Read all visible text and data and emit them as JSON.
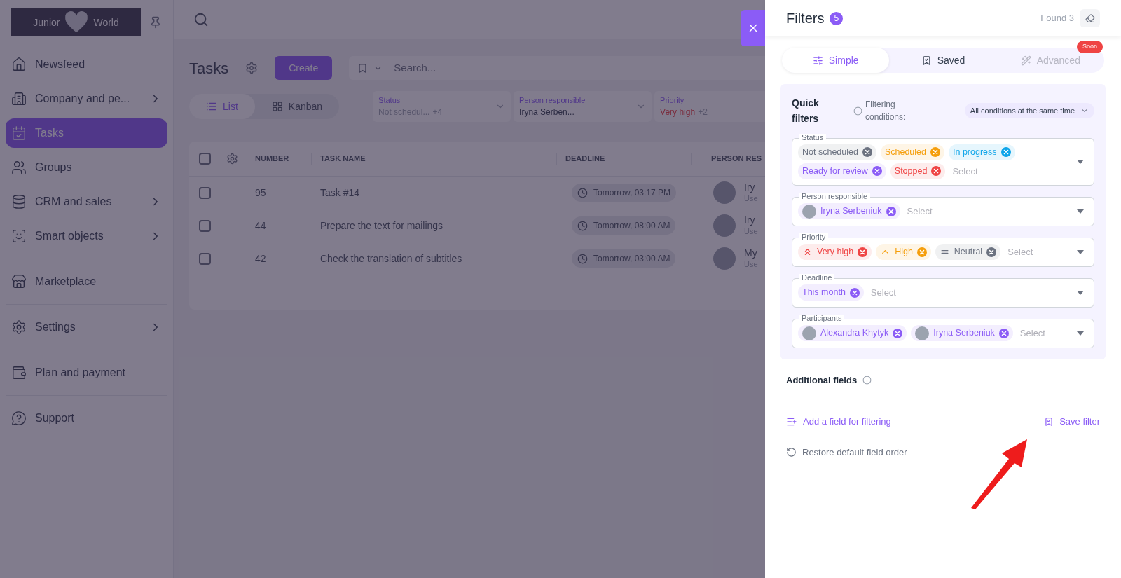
{
  "sidebar": {
    "logo": {
      "left": "Junior",
      "right": "World"
    },
    "groups": [
      [
        {
          "label": "Newsfeed",
          "chevron": false,
          "selected": false
        },
        {
          "label": "Company and pe...",
          "chevron": true,
          "selected": false
        },
        {
          "label": "Tasks",
          "chevron": false,
          "selected": true
        },
        {
          "label": "Groups",
          "chevron": false,
          "selected": false
        },
        {
          "label": "CRM and sales",
          "chevron": true,
          "selected": false
        },
        {
          "label": "Smart objects",
          "chevron": true,
          "selected": false
        }
      ],
      [
        {
          "label": "Marketplace",
          "chevron": false,
          "selected": false
        }
      ],
      [
        {
          "label": "Settings",
          "chevron": true,
          "selected": false
        }
      ],
      [
        {
          "label": "Plan and payment",
          "chevron": false,
          "selected": false
        }
      ],
      [
        {
          "label": "Support",
          "chevron": false,
          "selected": false
        }
      ]
    ]
  },
  "page": {
    "title": "Tasks",
    "create": "Create",
    "search": {
      "placeholder": "Search..."
    },
    "views": [
      {
        "label": "List",
        "selected": true
      },
      {
        "label": "Kanban",
        "selected": false
      }
    ],
    "filters": [
      {
        "label": "Status",
        "value": "Not schedul...",
        "extra": "+4",
        "kind": "muted"
      },
      {
        "label": "Person responsible",
        "value": "Iryna Serben...",
        "kind": "plain"
      },
      {
        "label": "Priority",
        "value": "Very high",
        "extra": "+2",
        "kind": "alert"
      }
    ]
  },
  "table": {
    "all_checked": false,
    "columns": [
      "NUMBER",
      "TASK NAME",
      "DEADLINE",
      "PERSON RES"
    ],
    "rows": [
      {
        "checked": false,
        "number": "95",
        "name": "Task #14",
        "deadline": "Tomorrow, 03:17 PM",
        "person": "Iry",
        "role": "Use"
      },
      {
        "checked": false,
        "number": "44",
        "name": "Prepare the text for mailings",
        "deadline": "Tomorrow, 08:00 AM",
        "person": "Iry",
        "role": "Use"
      },
      {
        "checked": false,
        "number": "42",
        "name": "Check the translation of subtitles",
        "deadline": "Tomorrow, 03:00 AM",
        "person": "My",
        "role": "Use"
      }
    ]
  },
  "panel": {
    "title": "Filters",
    "count": "5",
    "found": "Found 3",
    "tabs": [
      {
        "label": "Simple",
        "selected": true,
        "disabled": false
      },
      {
        "label": "Saved",
        "selected": false,
        "disabled": false
      },
      {
        "label": "Advanced",
        "selected": false,
        "disabled": true,
        "badge": "Soon"
      }
    ],
    "quick": {
      "title": "Quick filters",
      "conditions_label": "Filtering conditions:",
      "conditions_value": "All conditions at the same time"
    },
    "fields": [
      {
        "label": "Status",
        "placeholder": "Select",
        "tags": [
          {
            "kind": "plain",
            "text": "Not scheduled",
            "color": "#6b7280"
          },
          {
            "kind": "plain",
            "text": "Scheduled",
            "color": "#f59e0b"
          },
          {
            "kind": "plain",
            "text": "In progress",
            "color": "#0ea5e9"
          },
          {
            "kind": "plain",
            "text": "Ready for review",
            "color": "#8b5cf6"
          },
          {
            "kind": "plain",
            "text": "Stopped",
            "color": "#ef4444"
          }
        ]
      },
      {
        "label": "Person responsible",
        "placeholder": "Select",
        "tags": [
          {
            "kind": "avatar",
            "text": "Iryna Serbeniuk",
            "color": "#8b5cf6"
          }
        ]
      },
      {
        "label": "Priority",
        "placeholder": "Select",
        "tags": [
          {
            "kind": "doubleup",
            "text": "Very high",
            "color": "#ef4444"
          },
          {
            "kind": "up",
            "text": "High",
            "color": "#f59e0b"
          },
          {
            "kind": "equal",
            "text": "Neutral",
            "color": "#6b7280"
          }
        ]
      },
      {
        "label": "Deadline",
        "placeholder": "Select",
        "tags": [
          {
            "kind": "plain",
            "text": "This month",
            "color": "#8b5cf6"
          }
        ]
      },
      {
        "label": "Participants",
        "placeholder": "Select",
        "tags": [
          {
            "kind": "avatar",
            "text": "Alexandra Khytyk",
            "color": "#8b5cf6"
          },
          {
            "kind": "avatar",
            "text": "Iryna Serbeniuk",
            "color": "#8b5cf6"
          }
        ]
      }
    ],
    "additional": "Additional fields",
    "add_field": "Add a field for filtering",
    "save": "Save filter",
    "restore": "Restore default field order"
  }
}
